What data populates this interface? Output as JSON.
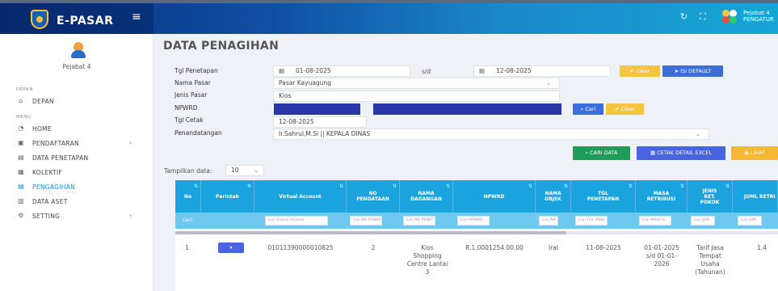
{
  "app": {
    "title": "E-PASAR"
  },
  "user": {
    "name": "Pejabat 4",
    "role": "PENGATUR"
  },
  "sidebar": {
    "username": "Pejabat 4",
    "section_depan": "DEPAN",
    "section_menu": "MENU",
    "items": [
      {
        "label": "DEPAN",
        "icon": "home-icon"
      },
      {
        "label": "HOME",
        "icon": "dashboard-icon"
      },
      {
        "label": "PENDAFTARAN",
        "icon": "register-icon",
        "has_submenu": true
      },
      {
        "label": "DATA PENETAPAN",
        "icon": "document-icon"
      },
      {
        "label": "KOLEKTIF",
        "icon": "collective-icon"
      },
      {
        "label": "PENGAGIHAN",
        "icon": "billing-icon",
        "active": true
      },
      {
        "label": "DATA ASET",
        "icon": "asset-icon"
      },
      {
        "label": "SETTING",
        "icon": "settings-icon",
        "has_submenu": true
      }
    ],
    "chevron": "›"
  },
  "page": {
    "title": "DATA PENAGIHAN"
  },
  "form": {
    "tgl_penetapan_label": "Tgl Penetapan",
    "date_from": "01-08-2025",
    "sd_label": "s/d",
    "date_to": "12-08-2025",
    "nama_pasar_label": "Nama Pasar",
    "nama_pasar_value": "Pasar Kayuagung",
    "jenis_pasar_label": "Jenis Pasar",
    "jenis_pasar_value": "Kios",
    "npwrd_label": "NPWRD",
    "tgl_cetak_label": "Tgl Cetak",
    "tgl_cetak_value": "12-08-2025",
    "penandatangan_label": "Penandatangan",
    "penandatangan_value": "Ir.Sahrul,M.Si || KEPALA DINAS"
  },
  "buttons": {
    "clear_top": "Clear",
    "isi_default": "ISI DEFAULT",
    "cari": "Cari",
    "clear_npwrd": "Clear",
    "cari_data": "CARI DATA",
    "cetak_excel": "CETAK DETAIL EXCEL",
    "lihat": "LIHAT"
  },
  "table": {
    "show_label": "Tampilkan data:",
    "page_size": "10",
    "columns": [
      "No",
      "Perintah",
      "Virtual Account",
      "NO PENDATAAN",
      "NAMA DAGANGAN",
      "NPWRD",
      "NAMA OBJEK",
      "TGL PENETAPAN",
      "MASA RETRIBUSI",
      "JENIS RET. POKOK",
      "JUML RETRI"
    ],
    "filter_label": "cari:",
    "filters": [
      "Cari Virtual Account",
      "Cari NO PENDA",
      "Cari NO PENET",
      "Cari NPWRD",
      "Cari NA",
      "Cari TGL PENE",
      "Cari MASA R",
      "Cari JENI",
      "Cari JUM"
    ],
    "rows": [
      {
        "no": "1",
        "action": "▾",
        "virtual_account": "01011390000010825",
        "no_pendataan": "2",
        "nama_dagangan": "Kios Shopping Centre Lantai 3",
        "npwrd": "R.1.0001254.00.00",
        "nama_objek": "Iral",
        "tgl_penetapan": "11-08-2025",
        "masa_retribusi": "01-01-2025 s/d 01-01-2026",
        "jenis_ret": "Tarif Jasa Tempat Usaha (Tahunan)",
        "jumlah": "1.4"
      }
    ]
  },
  "colors": {
    "header": "#1aa3dd",
    "active": "#1a8fd0",
    "navbar": "#0f4fa3"
  }
}
